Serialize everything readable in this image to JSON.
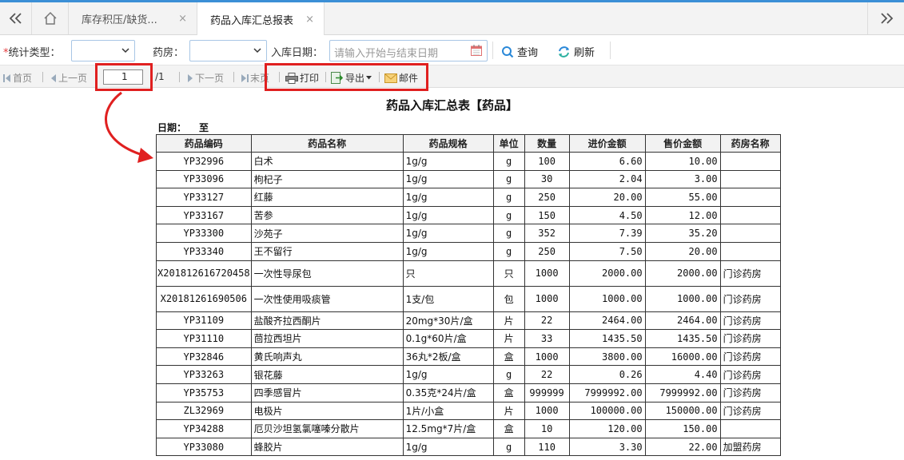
{
  "tabs": {
    "tab1_label": "库存积压/缺货...",
    "tab2_label": "药品入库汇总报表",
    "close_glyph": "×"
  },
  "filters": {
    "required_mark": "*",
    "stat_type_label": "统计类型：",
    "pharmacy_label": "药房：",
    "date_label": "入库日期：",
    "date_placeholder": "请输入开始与结束日期",
    "query_label": "查询",
    "refresh_label": "刷新"
  },
  "pager": {
    "first": "首页",
    "prev": "上一页",
    "page_value": "1",
    "total": "/1",
    "next": "下一页",
    "last": "末页",
    "print": "打印",
    "export": "导出",
    "mail": "邮件"
  },
  "report": {
    "title": "药品入库汇总表【药品】",
    "date_label": "日期：",
    "date_to": "至",
    "columns": [
      "药品编码",
      "药品名称",
      "药品规格",
      "单位",
      "数量",
      "进价金额",
      "售价金额",
      "药房名称"
    ],
    "rows": [
      [
        "YP32996",
        "白术",
        "1g/g",
        "g",
        "100",
        "6.60",
        "10.00",
        ""
      ],
      [
        "YP33096",
        "枸杞子",
        "1g/g",
        "g",
        "30",
        "2.04",
        "3.00",
        ""
      ],
      [
        "YP33127",
        "红藤",
        "1g/g",
        "g",
        "250",
        "20.00",
        "55.00",
        ""
      ],
      [
        "YP33167",
        "苦参",
        "1g/g",
        "g",
        "150",
        "4.50",
        "12.00",
        ""
      ],
      [
        "YP33300",
        "沙苑子",
        "1g/g",
        "g",
        "352",
        "7.39",
        "35.20",
        ""
      ],
      [
        "YP33340",
        "王不留行",
        "1g/g",
        "g",
        "250",
        "7.50",
        "20.00",
        ""
      ],
      [
        "X201812616720458",
        "一次性导尿包",
        "只",
        "只",
        "1000",
        "2000.00",
        "2000.00",
        "门诊药房"
      ],
      [
        "X20181261690506",
        "一次性使用吸痰管",
        "1支/包",
        "包",
        "1000",
        "1000.00",
        "1000.00",
        "门诊药房"
      ],
      [
        "YP31109",
        "盐酸齐拉西酮片",
        "20mg*30片/盒",
        "片",
        "22",
        "2464.00",
        "2464.00",
        "门诊药房"
      ],
      [
        "YP31110",
        "茴拉西坦片",
        "0.1g*60片/盒",
        "片",
        "33",
        "1435.50",
        "1435.50",
        "门诊药房"
      ],
      [
        "YP32846",
        "黄氏响声丸",
        "36丸*2板/盒",
        "盒",
        "1000",
        "3800.00",
        "16000.00",
        "门诊药房"
      ],
      [
        "YP33263",
        "银花藤",
        "1g/g",
        "g",
        "22",
        "0.26",
        "4.40",
        "门诊药房"
      ],
      [
        "YP35753",
        "四季感冒片",
        "0.35克*24片/盒",
        "盒",
        "999999",
        "7999992.00",
        "7999992.00",
        "门诊药房"
      ],
      [
        "ZL32969",
        "电极片",
        "1片/小盒",
        "片",
        "1000",
        "100000.00",
        "150000.00",
        "门诊药房"
      ],
      [
        "YP34288",
        "厄贝沙坦氢氯噻嗪分散片",
        "12.5mg*7片/盒",
        "盒",
        "10",
        "120.00",
        "150.00",
        ""
      ],
      [
        "YP33080",
        "蜂胶片",
        "1g/g",
        "g",
        "110",
        "3.30",
        "22.00",
        "加盟药房"
      ]
    ]
  }
}
